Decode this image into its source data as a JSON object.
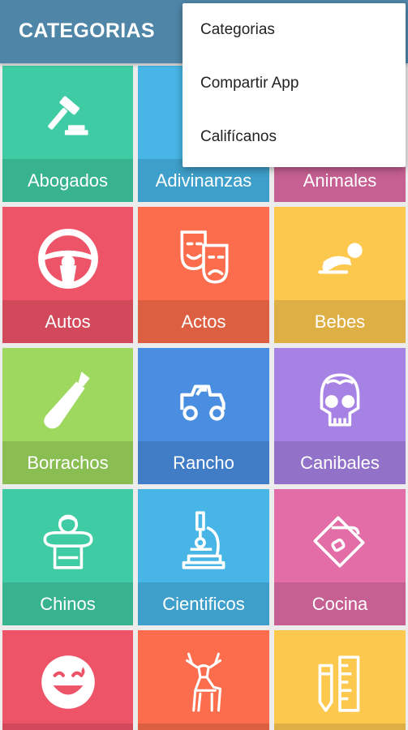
{
  "appbar": {
    "title": "CATEGORIAS"
  },
  "menu": {
    "items": [
      {
        "label": "Categorias"
      },
      {
        "label": "Compartir App"
      },
      {
        "label": "Califícanos"
      }
    ]
  },
  "tiles": [
    {
      "label": "Abogados",
      "color": "#3fcca4",
      "icon": "gavel-icon"
    },
    {
      "label": "Adivinanzas",
      "color": "#47b6e6",
      "icon": "question-icon"
    },
    {
      "label": "Animales",
      "color": "#e36ea7",
      "icon": "animal-icon"
    },
    {
      "label": "Autos",
      "color": "#ee5468",
      "icon": "steering-wheel-icon"
    },
    {
      "label": "Actos",
      "color": "#fb6d4c",
      "icon": "theater-masks-icon"
    },
    {
      "label": "Bebes",
      "color": "#fdc84e",
      "icon": "crawling-baby-icon"
    },
    {
      "label": "Borrachos",
      "color": "#9ed85e",
      "icon": "bottle-icon"
    },
    {
      "label": "Rancho",
      "color": "#4a8ee2",
      "icon": "tractor-icon"
    },
    {
      "label": "Canibales",
      "color": "#a782e5",
      "icon": "skull-brain-icon"
    },
    {
      "label": "Chinos",
      "color": "#3fcca4",
      "icon": "chinese-man-icon"
    },
    {
      "label": "Cientificos",
      "color": "#47b6e6",
      "icon": "microscope-icon"
    },
    {
      "label": "Cocina",
      "color": "#e36ea7",
      "icon": "cutting-board-icon"
    },
    {
      "label": "",
      "color": "#ee5468",
      "icon": "laughing-face-icon"
    },
    {
      "label": "",
      "color": "#fb6d4c",
      "icon": "deer-icon"
    },
    {
      "label": "",
      "color": "#fdc84e",
      "icon": "pencil-ruler-icon"
    }
  ]
}
